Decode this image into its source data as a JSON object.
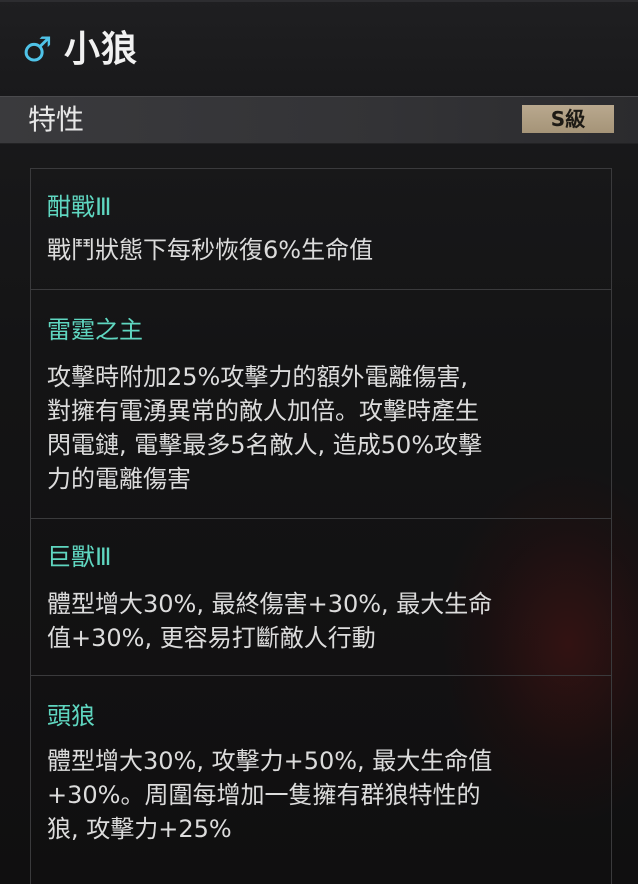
{
  "header": {
    "gender_icon": "male-icon",
    "gender_symbol": "♂",
    "title": "小狼"
  },
  "section": {
    "label": "特性",
    "grade": "S級"
  },
  "traits": [
    {
      "name": "酣戰Ⅲ",
      "desc": "戰鬥狀態下每秒恢復6%生命值"
    },
    {
      "name": "雷霆之主",
      "desc": "攻擊時附加25%攻擊力的額外電離傷害,\n對擁有電湧異常的敵人加倍。攻擊時產生\n閃電鏈, 電擊最多5名敵人, 造成50%攻擊\n力的電離傷害"
    },
    {
      "name": "巨獸Ⅲ",
      "desc": "體型增大30%, 最終傷害+30%, 最大生命\n值+30%, 更容易打斷敵人行動"
    },
    {
      "name": "頭狼",
      "desc": "體型增大30%, 攻擊力+50%, 最大生命值\n+30%。周圍每增加一隻擁有群狼特性的\n狼, 攻擊力+25%"
    }
  ],
  "colors": {
    "gender_icon": "#4fc3e8",
    "trait_name": "#5fd6c0",
    "grade_badge": "#b9a88e"
  }
}
